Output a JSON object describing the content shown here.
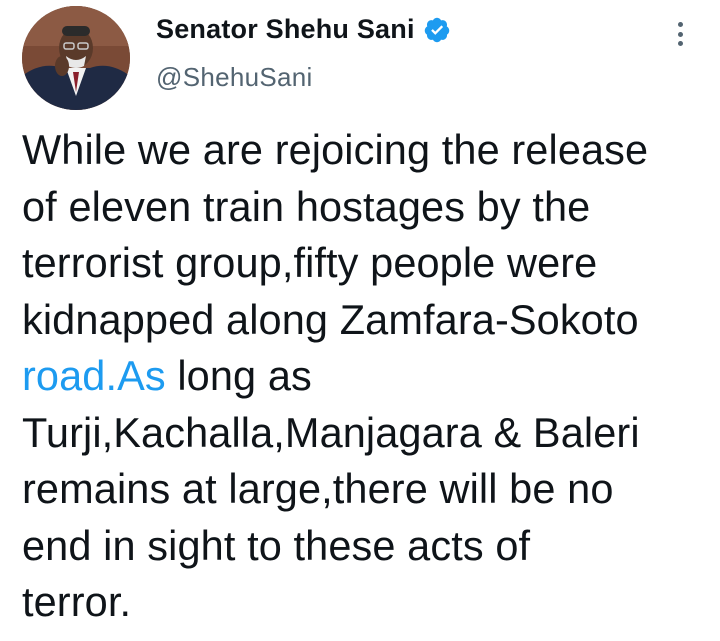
{
  "author": {
    "display_name": "Senator Shehu Sani",
    "handle": "@ShehuSani",
    "verified": true,
    "verified_icon": "verified-badge-icon",
    "avatar_icon": "profile-avatar"
  },
  "menu": {
    "more_icon": "more-vertical-icon"
  },
  "tweet": {
    "lines": [
      {
        "before": "While we are rejoicing the release",
        "link": "",
        "after": ""
      },
      {
        "before": "of eleven train hostages by the",
        "link": "",
        "after": ""
      },
      {
        "before": "terrorist group,fifty people were",
        "link": "",
        "after": ""
      },
      {
        "before": "kidnapped along Zamfara-Sokoto",
        "link": "",
        "after": ""
      },
      {
        "before": "",
        "link": "road.As",
        "after": " long as"
      },
      {
        "before": "Turji,Kachalla,Manjagara & Baleri",
        "link": "",
        "after": ""
      },
      {
        "before": "remains at large,there will be no",
        "link": "",
        "after": ""
      },
      {
        "before": "end in sight to these acts of",
        "link": "",
        "after": ""
      },
      {
        "before": "terror.",
        "link": "",
        "after": ""
      }
    ]
  },
  "colors": {
    "text": "#0f1419",
    "secondary_text": "#536471",
    "link": "#1d9bf0",
    "verified": "#1d9bf0"
  }
}
